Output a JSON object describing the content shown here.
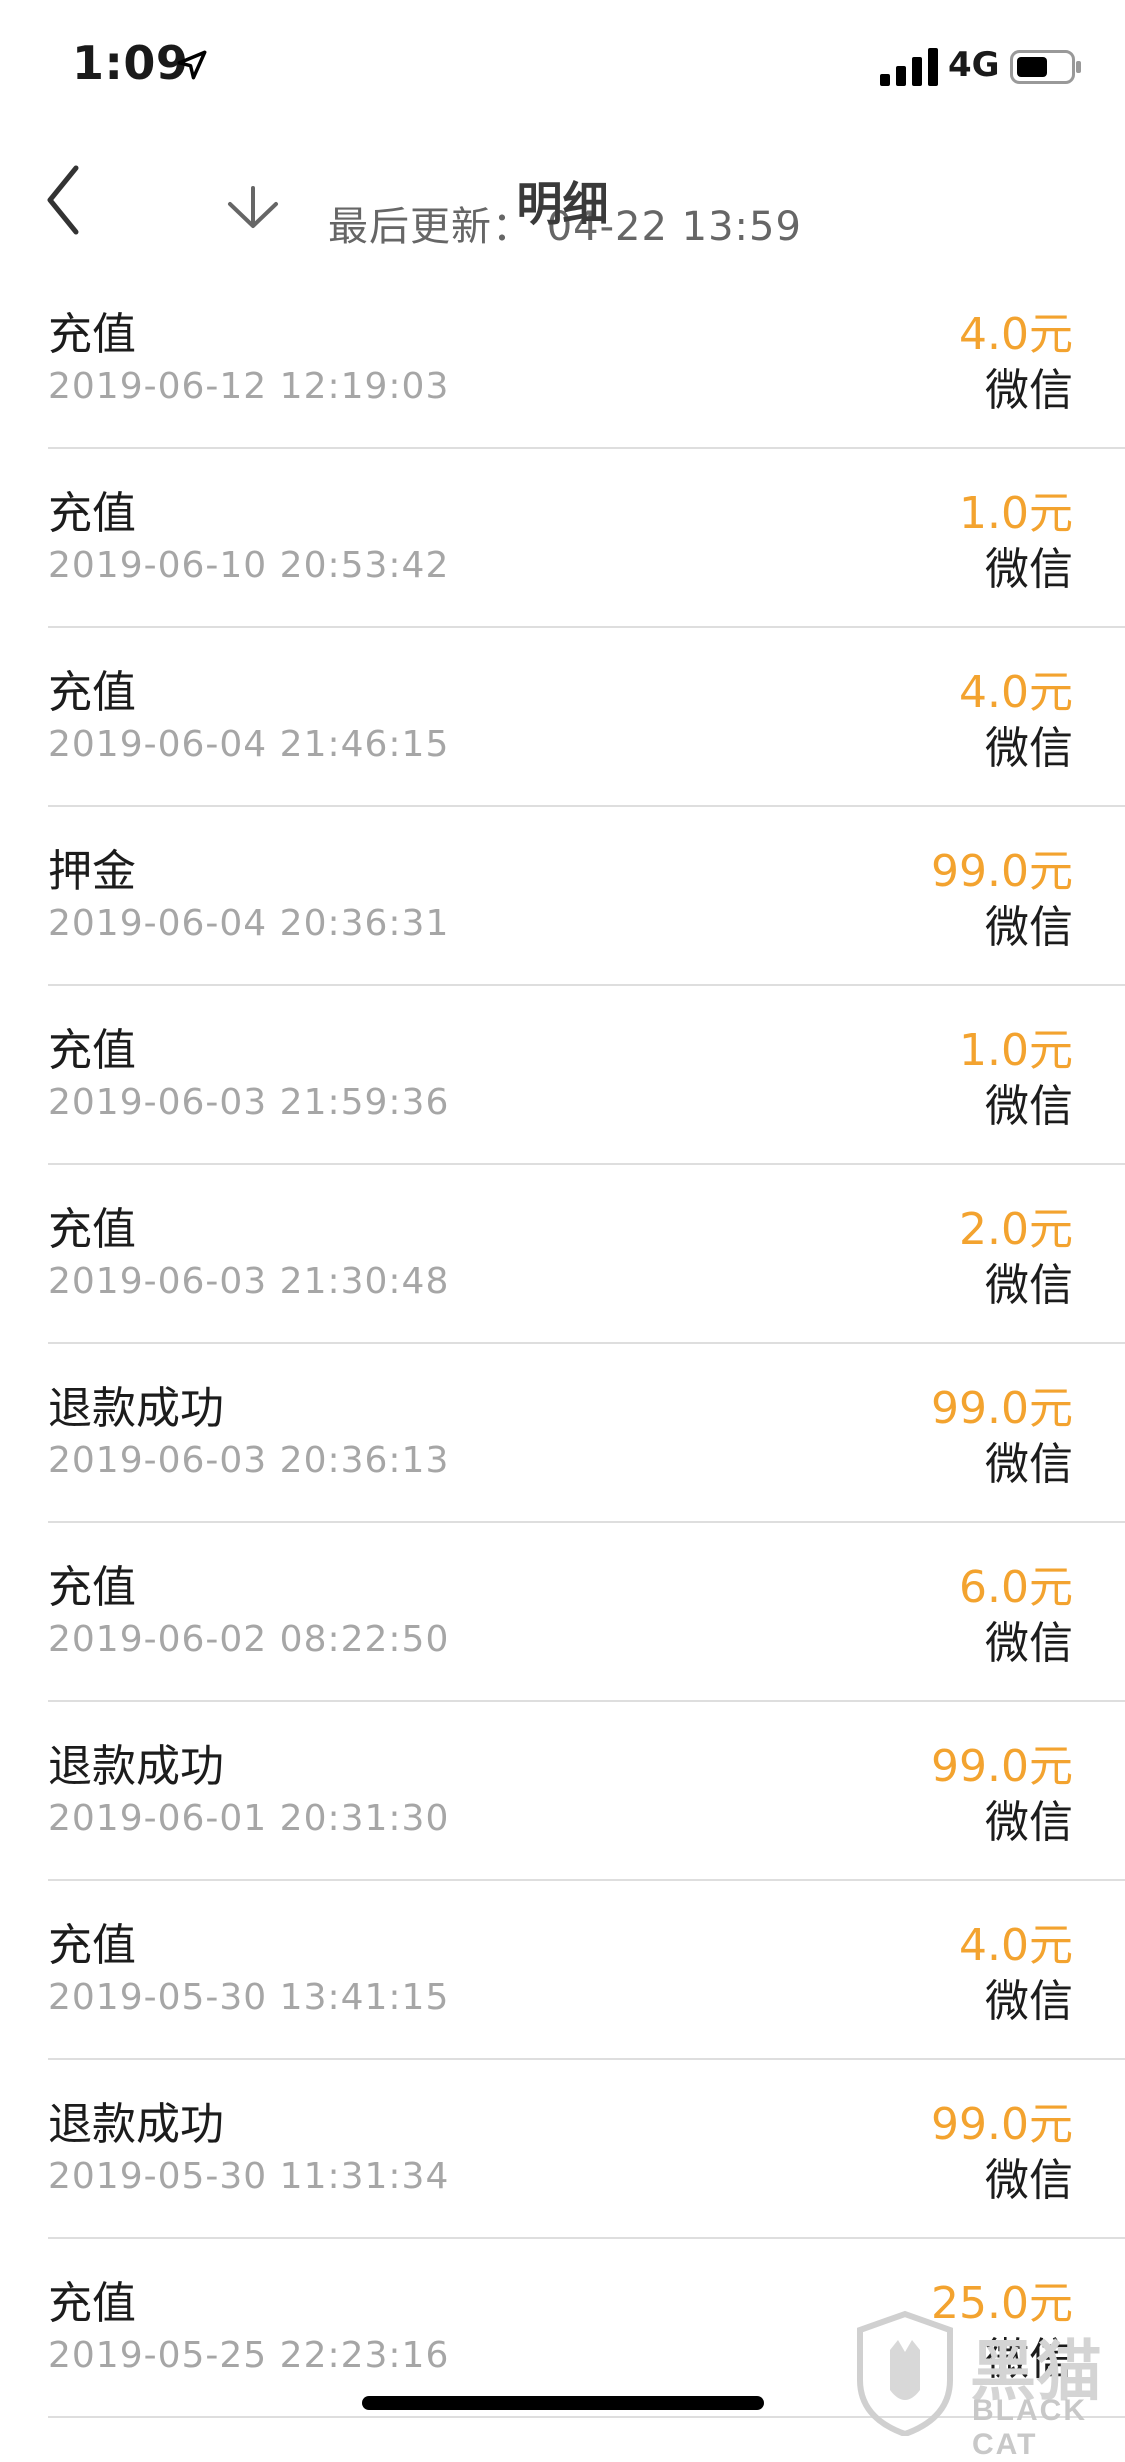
{
  "status_bar": {
    "time": "1:09",
    "network": "4G",
    "icons": [
      "location-arrow-icon",
      "signal-bars-icon",
      "battery-icon"
    ]
  },
  "nav": {
    "title": "明细",
    "last_updated": "最后更新：  04-22 13:59",
    "icons": [
      "back-chevron-icon",
      "pull-down-arrow-icon"
    ]
  },
  "colors": {
    "amount": "#f3a32f",
    "primary_text": "#1c1c1c",
    "secondary_text": "#a6a6a6",
    "divider": "#dedede"
  },
  "transactions": [
    {
      "type": "充值",
      "time": "2019-06-12 12:19:03",
      "amount": "4.0元",
      "method": "微信"
    },
    {
      "type": "充值",
      "time": "2019-06-10 20:53:42",
      "amount": "1.0元",
      "method": "微信"
    },
    {
      "type": "充值",
      "time": "2019-06-04 21:46:15",
      "amount": "4.0元",
      "method": "微信"
    },
    {
      "type": "押金",
      "time": "2019-06-04 20:36:31",
      "amount": "99.0元",
      "method": "微信"
    },
    {
      "type": "充值",
      "time": "2019-06-03 21:59:36",
      "amount": "1.0元",
      "method": "微信"
    },
    {
      "type": "充值",
      "time": "2019-06-03 21:30:48",
      "amount": "2.0元",
      "method": "微信"
    },
    {
      "type": "退款成功",
      "time": "2019-06-03 20:36:13",
      "amount": "99.0元",
      "method": "微信"
    },
    {
      "type": "充值",
      "time": "2019-06-02 08:22:50",
      "amount": "6.0元",
      "method": "微信"
    },
    {
      "type": "退款成功",
      "time": "2019-06-01 20:31:30",
      "amount": "99.0元",
      "method": "微信"
    },
    {
      "type": "充值",
      "time": "2019-05-30 13:41:15",
      "amount": "4.0元",
      "method": "微信"
    },
    {
      "type": "退款成功",
      "time": "2019-05-30 11:31:34",
      "amount": "99.0元",
      "method": "微信"
    },
    {
      "type": "充值",
      "time": "2019-05-25 22:23:16",
      "amount": "25.0元",
      "method": "微信"
    }
  ],
  "watermark": {
    "text": "BLACK CAT",
    "chinese": "黑猫"
  }
}
